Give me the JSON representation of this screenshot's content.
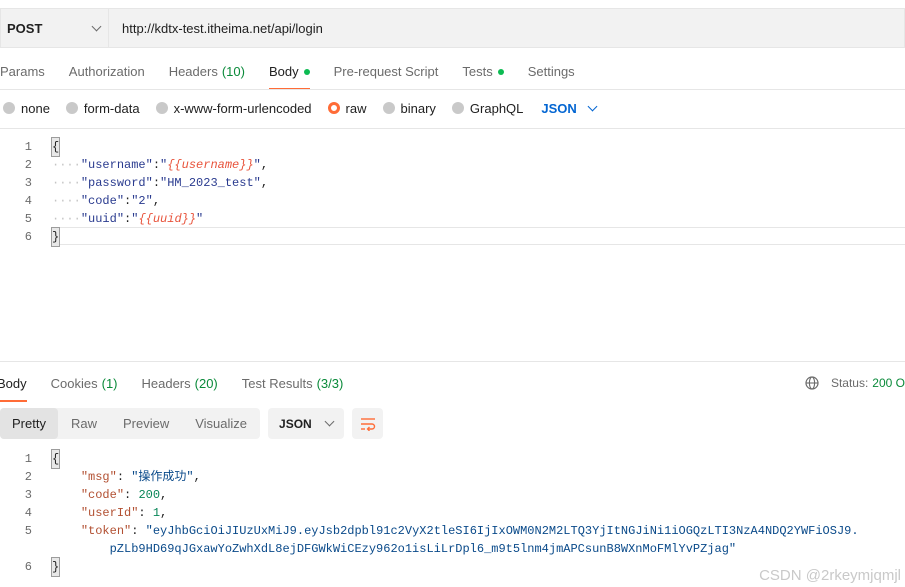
{
  "request": {
    "method": "POST",
    "url": "http://kdtx-test.itheima.net/api/login"
  },
  "request_tabs": [
    {
      "label": "Params",
      "count": "",
      "dot": false,
      "active": false
    },
    {
      "label": "Authorization",
      "count": "",
      "dot": false,
      "active": false
    },
    {
      "label": "Headers",
      "count": "(10)",
      "dot": false,
      "active": false
    },
    {
      "label": "Body",
      "count": "",
      "dot": true,
      "active": true
    },
    {
      "label": "Pre-request Script",
      "count": "",
      "dot": false,
      "active": false
    },
    {
      "label": "Tests",
      "count": "",
      "dot": true,
      "active": false
    },
    {
      "label": "Settings",
      "count": "",
      "dot": false,
      "active": false
    }
  ],
  "body_types": [
    "none",
    "form-data",
    "x-www-form-urlencoded",
    "raw",
    "binary",
    "GraphQL"
  ],
  "body_type_selected": "raw",
  "body_format": "JSON",
  "request_body": {
    "line_numbers": [
      "1",
      "2",
      "3",
      "4",
      "5",
      "6"
    ],
    "open": "{",
    "close": "}",
    "k_username": "\"username\"",
    "v_username_var": "{{username}}",
    "k_password": "\"password\"",
    "v_password": "\"HM_2023_test\"",
    "k_code": "\"code\"",
    "v_code": "\"2\"",
    "k_uuid": "\"uuid\"",
    "v_uuid_var": "{{uuid}}"
  },
  "response_tabs": [
    {
      "label": "Body",
      "count": "",
      "active": true
    },
    {
      "label": "Cookies",
      "count": "(1)",
      "active": false
    },
    {
      "label": "Headers",
      "count": "(20)",
      "active": false
    },
    {
      "label": "Test Results",
      "count": "(3/3)",
      "active": false
    }
  ],
  "status": {
    "label": "Status:",
    "value": "200 O"
  },
  "view_modes": [
    "Pretty",
    "Raw",
    "Preview",
    "Visualize"
  ],
  "view_mode_active": "Pretty",
  "response_format": "JSON",
  "response_body": {
    "line_numbers": [
      "1",
      "2",
      "3",
      "4",
      "5",
      "6"
    ],
    "open": "{",
    "close": "}",
    "k_msg": "\"msg\"",
    "v_msg": "\"操作成功\"",
    "k_code": "\"code\"",
    "v_code": "200",
    "k_userId": "\"userId\"",
    "v_userId": "1",
    "k_token": "\"token\"",
    "v_token_1": "\"eyJhbGciOiJIUzUxMiJ9.eyJsb2dpbl91c2VyX2tleSI6IjIxOWM0N2M2LTQ3YjItNGJiNi1iOGQzLTI3NzA4NDQ2YWFiOSJ9.",
    "v_token_2": "pZLb9HD69qJGxawYoZwhXdL8ejDFGWkWiCEzy962o1isLiLrDpl6_m9t5lnm4jmAPCsunB8WXnMoFMlYvPZjag\""
  },
  "watermark": "CSDN @2rkeymjqmjl",
  "colors": {
    "accent": "#ff6c37",
    "link_blue": "#0265d2",
    "success_green": "#0a8a3a"
  }
}
